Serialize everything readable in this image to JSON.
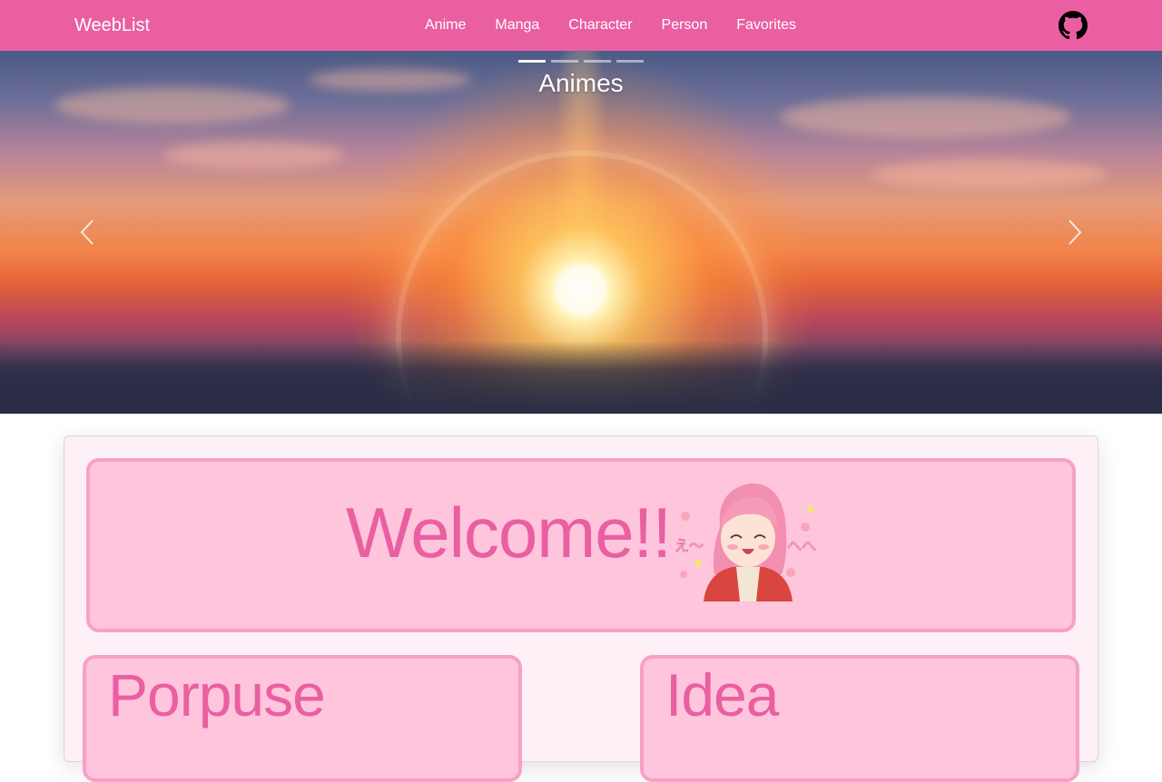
{
  "navbar": {
    "brand": "WeebList",
    "links": [
      "Anime",
      "Manga",
      "Character",
      "Person",
      "Favorites"
    ],
    "icon": "github-icon",
    "background": "#ea5fa1"
  },
  "carousel": {
    "caption": "Animes",
    "slide_count": 4,
    "active_slide": 1,
    "prev_icon": "chevron-left-icon",
    "next_icon": "chevron-right-icon"
  },
  "welcome": {
    "title": "Welcome!!",
    "mascot": "anime-girl-mascot"
  },
  "cards": [
    {
      "title": "Porpuse"
    },
    {
      "title": "Idea"
    }
  ],
  "colors": {
    "accent": "#ea5fa1",
    "box_fill": "#fec5dd",
    "box_border": "#f8a0c6",
    "panel": "#fdf0f6"
  }
}
